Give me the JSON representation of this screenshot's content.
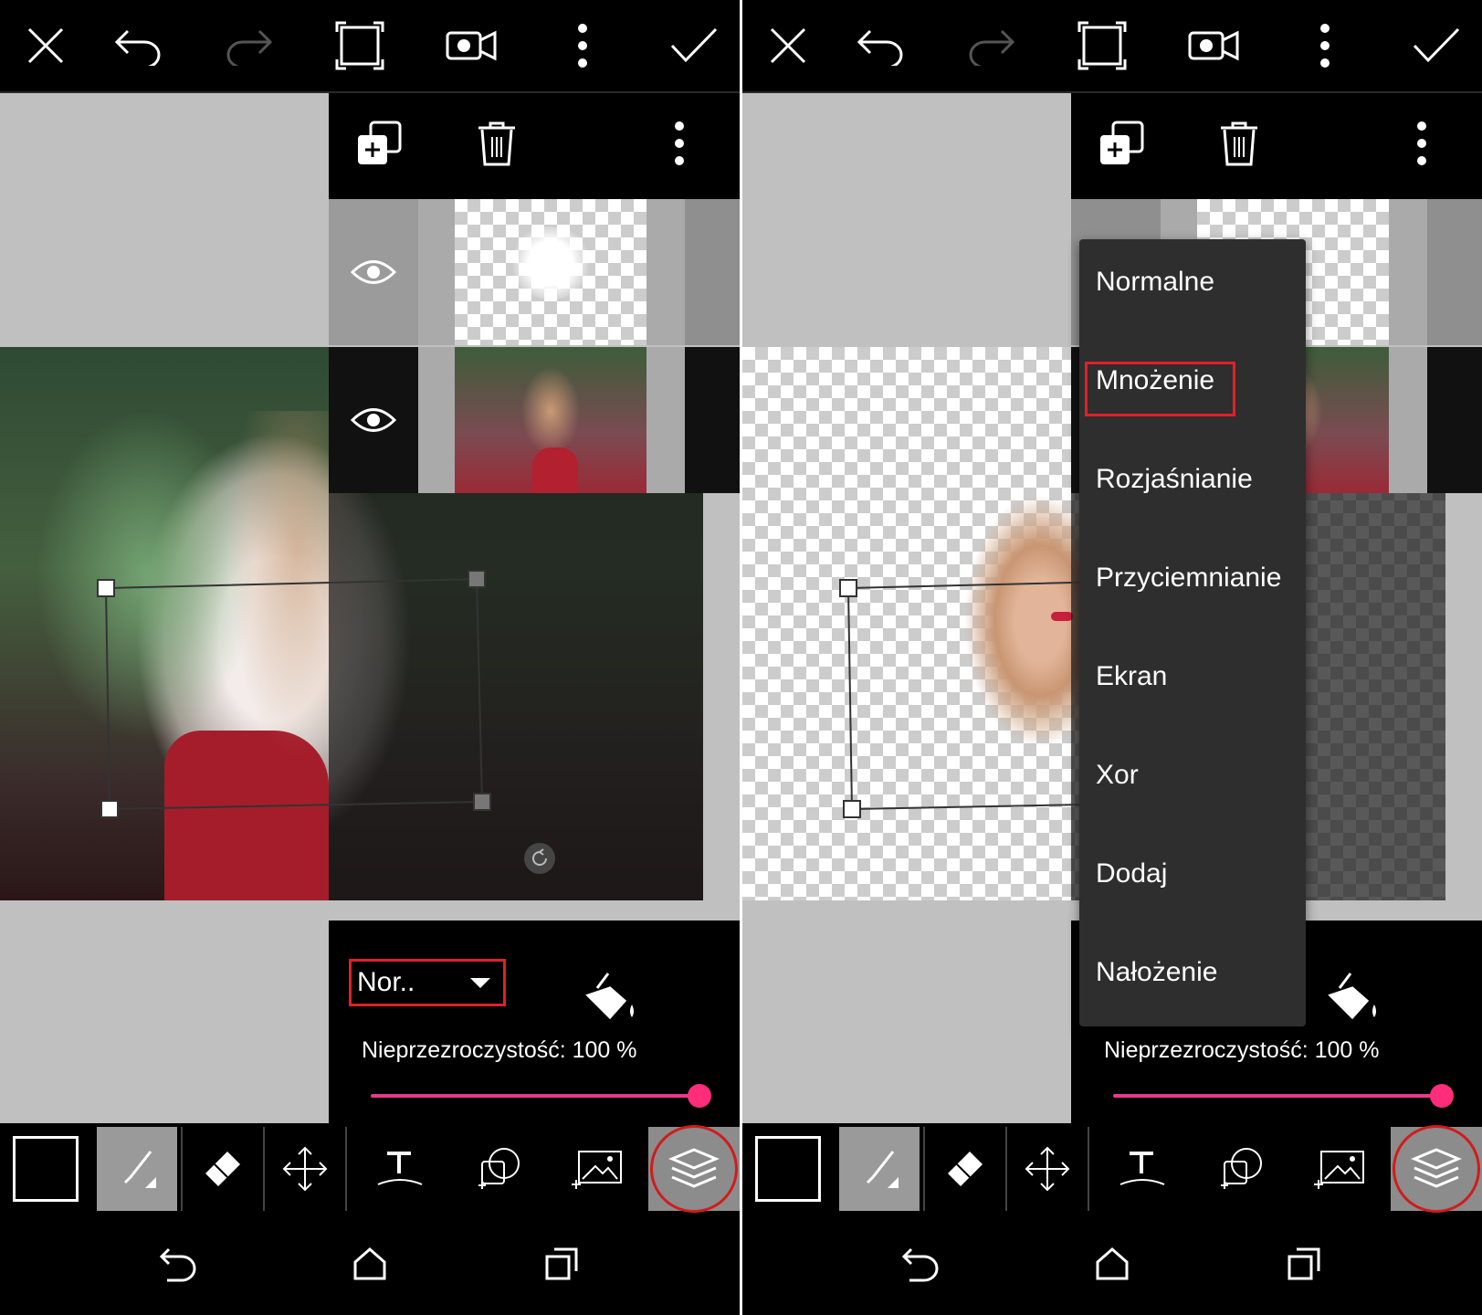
{
  "toolbar_top": {
    "icons": [
      "close-icon",
      "undo-icon",
      "redo-icon",
      "crop-frame-icon",
      "video-record-icon",
      "more-vertical-icon",
      "check-icon"
    ]
  },
  "layers": {
    "header_icons": [
      "add-layer-icon",
      "trash-icon",
      "more-vertical-icon"
    ]
  },
  "blend": {
    "selected_label": "Nor..",
    "options": [
      "Normalne",
      "Mnożenie",
      "Rozjaśnianie",
      "Przyciemnianie",
      "Ekran",
      "Xor",
      "Dodaj",
      "Nałożenie"
    ],
    "highlighted": "Mnożenie"
  },
  "opacity": {
    "label": "Nieprzezroczystość: 100 %",
    "value": 100
  },
  "tools": [
    "color-swatch",
    "brush-icon",
    "eraser-icon",
    "move-icon",
    "text-icon",
    "sticker-icon",
    "add-photo-icon",
    "layers-icon"
  ],
  "nav": [
    "back-icon",
    "home-icon",
    "recents-icon"
  ],
  "colors": {
    "accent": "#ff2d7a",
    "highlight_box": "#e0202a",
    "menu_bg": "#2e2e2e",
    "canvas_bg": "#c0c0c0"
  }
}
